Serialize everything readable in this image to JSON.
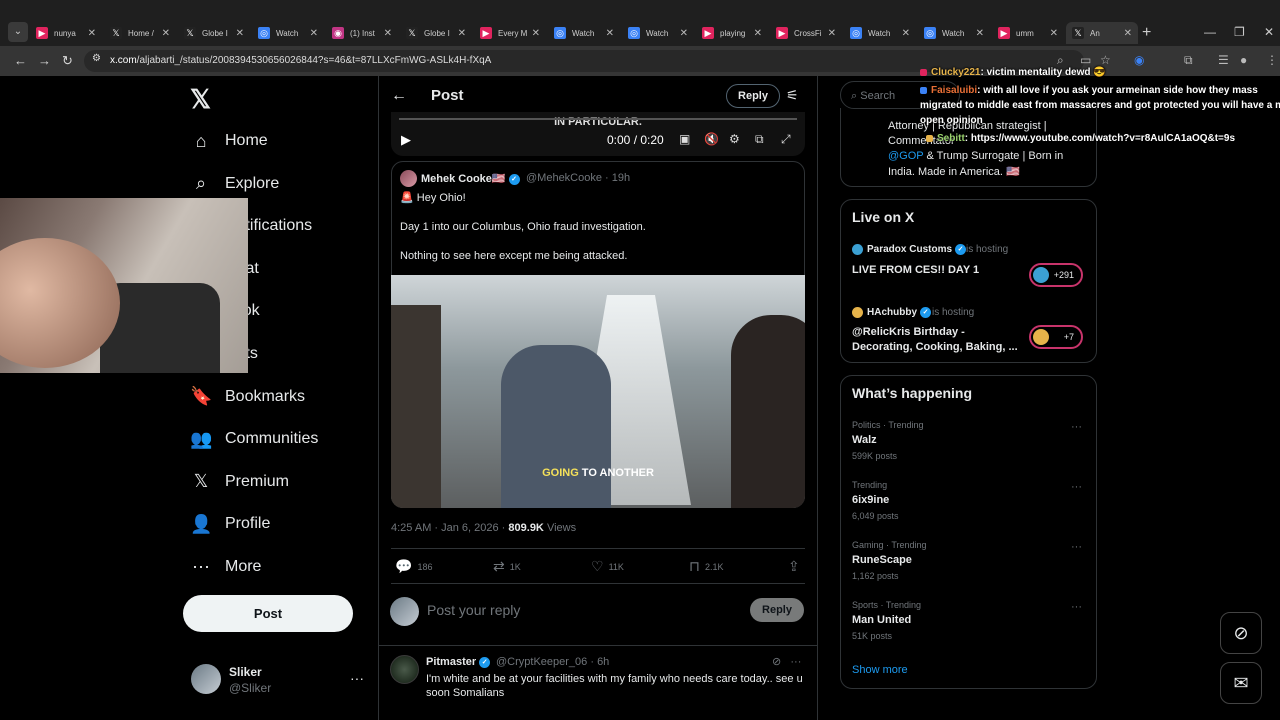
{
  "browser": {
    "tabs": [
      {
        "title": "nunya",
        "color": "#e0245e",
        "icon": "youtube-icon"
      },
      {
        "title": "Home /",
        "color": "#222",
        "icon": "x-icon"
      },
      {
        "title": "Globe I",
        "color": "#222",
        "icon": "x-icon"
      },
      {
        "title": "Watch",
        "color": "#3b82f6",
        "icon": "kick-icon"
      },
      {
        "title": "(1) Inst",
        "color": "#c13584",
        "icon": "instagram-icon"
      },
      {
        "title": "Globe I",
        "color": "#222",
        "icon": "x-icon"
      },
      {
        "title": "Every M",
        "color": "#e0245e",
        "icon": "youtube-icon"
      },
      {
        "title": "Watch",
        "color": "#3b82f6",
        "icon": "kick-icon"
      },
      {
        "title": "Watch",
        "color": "#3b82f6",
        "icon": "kick-icon"
      },
      {
        "title": "playing",
        "color": "#e0245e",
        "icon": "youtube-icon"
      },
      {
        "title": "CrossFi",
        "color": "#e0245e",
        "icon": "youtube-icon"
      },
      {
        "title": "Watch",
        "color": "#3b82f6",
        "icon": "kick-icon"
      },
      {
        "title": "Watch",
        "color": "#3b82f6",
        "icon": "kick-icon"
      },
      {
        "title": "umm",
        "color": "#e0245e",
        "icon": "youtube-icon"
      },
      {
        "title": "An",
        "color": "#222",
        "icon": "x-icon"
      }
    ],
    "url_host": "x.com",
    "url_path": "/aljabarti_/status/2008394530656026844?s=46&t=87LLXcFmWG-ASLk4H-fXqA"
  },
  "nav": {
    "items": [
      {
        "label": "Home",
        "icon": "home-icon"
      },
      {
        "label": "Explore",
        "icon": "search-icon"
      },
      {
        "label": "Notifications",
        "icon": "bell-icon"
      },
      {
        "label": "Chat",
        "icon": "chat-icon"
      },
      {
        "label": "Grok",
        "icon": "grok-icon"
      },
      {
        "label": "Lists",
        "icon": "list-icon"
      },
      {
        "label": "Bookmarks",
        "icon": "bookmark-icon"
      },
      {
        "label": "Communities",
        "icon": "communities-icon"
      },
      {
        "label": "Premium",
        "icon": "x-icon"
      },
      {
        "label": "Profile",
        "icon": "person-icon"
      },
      {
        "label": "More",
        "icon": "more-icon"
      }
    ],
    "post_label": "Post",
    "me_name": "Sliker",
    "me_handle": "@Sliker"
  },
  "header": {
    "title": "Post",
    "reply_label": "Reply"
  },
  "video": {
    "subtitle": "IN PARTICULAR.",
    "time": "0:00 / 0:20"
  },
  "quote": {
    "name": "Mehek Cooke🇺🇸",
    "handle": "@MehekCooke",
    "age": "19h",
    "line1": "🚨 Hey Ohio!",
    "line2": "Day 1 into our Columbus, Ohio fraud investigation.",
    "line3": "Nothing to see here except me being attacked.",
    "caption_hl": "GOING",
    "caption_rest": " TO ANOTHER"
  },
  "post": {
    "timestamp": "4:25 AM · Jan 6, 2026 · ",
    "views": "809.9K",
    "views_label": " Views",
    "replies": "186",
    "reposts": "1K",
    "likes": "11K",
    "bookmarks": "2.1K"
  },
  "composer": {
    "placeholder": "Post your reply",
    "reply_label": "Reply"
  },
  "comment": {
    "name": "Pitmaster",
    "handle": "@CryptKeeper_06",
    "age": "6h",
    "text": "I'm white and be at your facilities with my family who needs care today.. see u soon Somalians"
  },
  "right": {
    "search_placeholder": "Search",
    "bio": {
      "line1": "Attorney | Republican strategist |",
      "line2": "Commentator",
      "line3_link": "@GOP",
      "line3_rest": " & Trump Surrogate | Born in",
      "line4": "India. Made in America. 🇺🇸"
    },
    "live": {
      "title": "Live on X",
      "items": [
        {
          "host": "Paradox Customs",
          "role": "is hosting",
          "title": "LIVE FROM CES!! DAY 1",
          "count": "+291"
        },
        {
          "host": "HAchubby",
          "role": "is hosting",
          "title": "@RelicKris Birthday -",
          "title2": "Decorating, Cooking, Baking, ...",
          "count": "+7"
        }
      ]
    },
    "happening": {
      "title": "What’s happening",
      "items": [
        {
          "meta": "Politics · Trending",
          "name": "Walz",
          "count": "599K posts"
        },
        {
          "meta": "Trending",
          "name": "6ix9ine",
          "count": "6,049 posts"
        },
        {
          "meta": "Gaming · Trending",
          "name": "RuneScape",
          "count": "1,162 posts"
        },
        {
          "meta": "Sports · Trending",
          "name": "Man United",
          "count": "51K posts"
        }
      ],
      "show_more": "Show more"
    }
  },
  "chat": [
    {
      "user": "Clucky221",
      "msg": ": victim mentality dewd 😎"
    },
    {
      "user": "Faisaluibi",
      "msg": ": with all love if you ask your armeinan side how they mass"
    },
    {
      "msg_cont": "migrated to middle east from massacres and got protected you will have a more"
    },
    {
      "msg_cont": "open opinion"
    },
    {
      "user": "Sebitt",
      "msg": ": https://www.youtube.com/watch?v=r8AulCA1aOQ&t=9s"
    }
  ]
}
